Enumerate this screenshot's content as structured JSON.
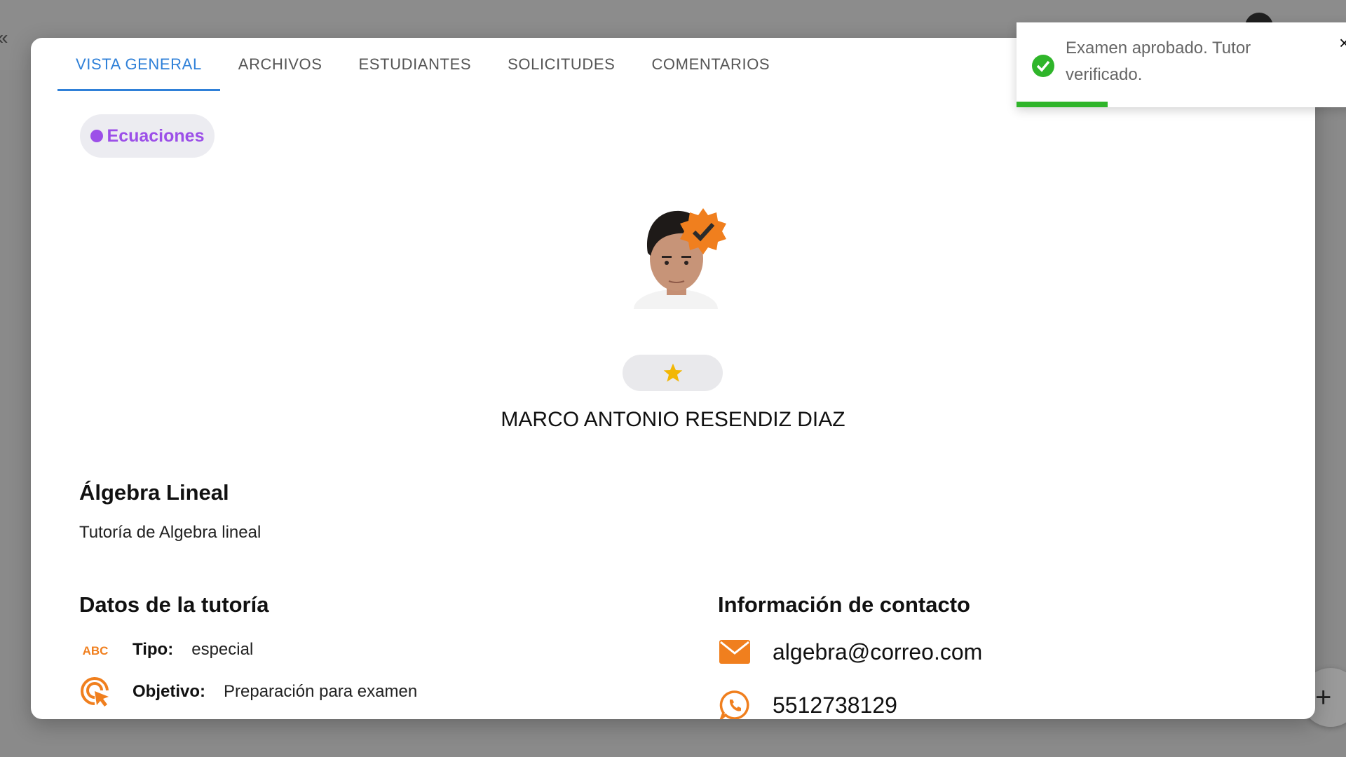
{
  "tabs": [
    {
      "label": "VISTA GENERAL",
      "active": true
    },
    {
      "label": "ARCHIVOS",
      "active": false
    },
    {
      "label": "ESTUDIANTES",
      "active": false
    },
    {
      "label": "SOLICITUDES",
      "active": false
    },
    {
      "label": "COMENTARIOS",
      "active": false
    }
  ],
  "tag": {
    "label": "Ecuaciones",
    "color": "#9c4fe8"
  },
  "tutor": {
    "name": "MARCO ANTONIO RESENDIZ DIAZ",
    "rating_stars": 1,
    "verified": true
  },
  "course": {
    "title": "Álgebra Lineal",
    "description": "Tutoría de Algebra lineal"
  },
  "details": {
    "title": "Datos de la tutoría",
    "type_icon_text": "ABC",
    "type_label": "Tipo:",
    "type_value": "especial",
    "objective_label": "Objetivo:",
    "objective_value": "Preparación para examen"
  },
  "contact": {
    "title": "Información de contacto",
    "email": "algebra@correo.com",
    "phone": "5512738129"
  },
  "toast": {
    "message": "Examen aprobado. Tutor verificado.",
    "close_glyph": "×",
    "progress": 0.27,
    "color": "#2fb52a"
  },
  "fab": {
    "glyph": "+"
  },
  "colors": {
    "accent": "#2f80d8",
    "icon_orange": "#f07f1e",
    "star": "#f2b705"
  }
}
